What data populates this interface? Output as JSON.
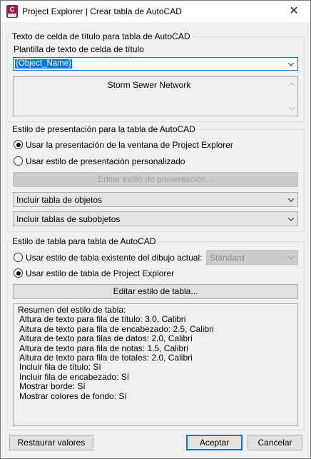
{
  "window": {
    "title": "Project Explorer | Crear tabla de AutoCAD",
    "app_icon_text": "C",
    "close_glyph": "✕"
  },
  "title_cell": {
    "group_label": "Texto de celda de título para tabla de AutoCAD",
    "template_label": "Plantilla de texto de celda de título",
    "template_value": "{Object_Name}",
    "preview_text": "Storm Sewer Network"
  },
  "presentation": {
    "group_label": "Estilo de presentación para la tabla de AutoCAD",
    "radio_window": "Usar la presentación de la ventana de Project Explorer",
    "radio_custom": "Usar estilo de presentación personalizado",
    "edit_button": "Editar estilo de presentación...",
    "combo_objects": "Incluir tabla de objetos",
    "combo_subobjects": "Incluir tablas de subobjetos"
  },
  "table_style": {
    "group_label": "Estilo de tabla para tabla de AutoCAD",
    "radio_existing": "Usar estilo de tabla existente del dibujo actual:",
    "existing_value": "Standard",
    "radio_pe": "Usar estilo de tabla de Project Explorer",
    "edit_button": "Editar estilo de tabla...",
    "summary_title": "Resumen del estilo de tabla:",
    "summary_lines": [
      "Altura de texto para fila de título: 3.0, Calibri",
      "Altura de texto para fila de encabezado: 2.5, Calibri",
      "Altura de texto para filas de datos: 2.0, Calibri",
      "Altura de texto para fila de notas: 1.5, Calibri",
      "Altura de texto para fila de totales: 2.0, Calibri",
      "Incluir fila de título: Sí",
      "Incluir fila de encabezado: Sí",
      "Mostrar borde: Sí",
      "Mostrar colores de fondo: Sí"
    ]
  },
  "footer": {
    "restore": "Restaurar valores",
    "accept": "Aceptar",
    "cancel": "Cancelar"
  }
}
